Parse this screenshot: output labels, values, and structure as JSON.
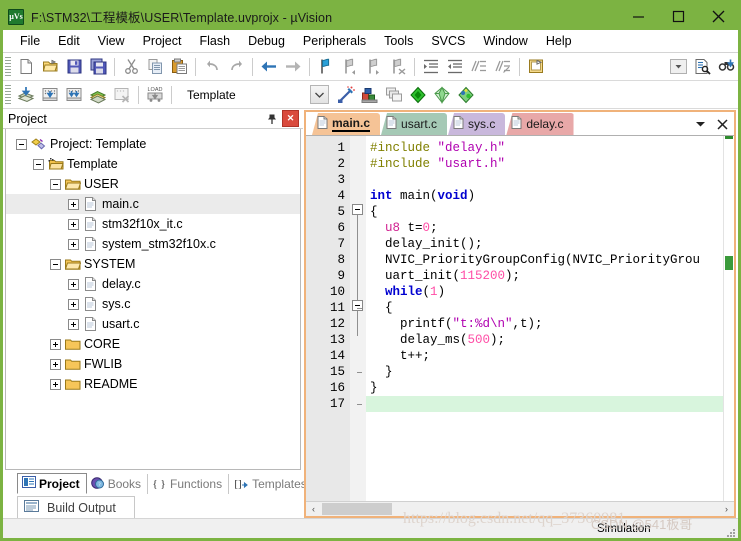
{
  "window": {
    "title": "F:\\STM32\\工程模板\\USER\\Template.uvprojx - µVision",
    "logo_text": "µVs",
    "minimize_label": "Minimize",
    "maximize_label": "Maximize",
    "close_label": "Close"
  },
  "menubar": {
    "items": [
      {
        "label": "File"
      },
      {
        "label": "Edit"
      },
      {
        "label": "View"
      },
      {
        "label": "Project"
      },
      {
        "label": "Flash"
      },
      {
        "label": "Debug"
      },
      {
        "label": "Peripherals"
      },
      {
        "label": "Tools"
      },
      {
        "label": "SVCS"
      },
      {
        "label": "Window"
      },
      {
        "label": "Help"
      }
    ]
  },
  "toolbar_main": {
    "buttons": [
      {
        "name": "new-file-icon",
        "tooltip": "New"
      },
      {
        "name": "open-file-icon",
        "tooltip": "Open"
      },
      {
        "name": "save-icon",
        "tooltip": "Save"
      },
      {
        "name": "save-all-icon",
        "tooltip": "Save All"
      },
      {
        "name": "cut-icon",
        "tooltip": "Cut"
      },
      {
        "name": "copy-icon",
        "tooltip": "Copy"
      },
      {
        "name": "paste-icon",
        "tooltip": "Paste"
      },
      {
        "name": "undo-icon",
        "tooltip": "Undo"
      },
      {
        "name": "redo-icon",
        "tooltip": "Redo"
      },
      {
        "name": "navigate-back-icon",
        "tooltip": "Back"
      },
      {
        "name": "navigate-forward-icon",
        "tooltip": "Forward"
      },
      {
        "name": "bookmark-toggle-icon",
        "tooltip": "Insert/Remove Bookmark"
      },
      {
        "name": "bookmark-prev-icon",
        "tooltip": "Previous Bookmark"
      },
      {
        "name": "bookmark-next-icon",
        "tooltip": "Next Bookmark"
      },
      {
        "name": "bookmark-clear-icon",
        "tooltip": "Clear All Bookmarks"
      },
      {
        "name": "indent-icon",
        "tooltip": "Indent Selected Text"
      },
      {
        "name": "outdent-icon",
        "tooltip": "Outdent Selected Text"
      },
      {
        "name": "comment-icon",
        "tooltip": "Comment Selection"
      },
      {
        "name": "uncomment-icon",
        "tooltip": "Uncomment Selection"
      },
      {
        "name": "bookmark-list-icon",
        "tooltip": "Bookmarks"
      }
    ],
    "right_buttons": [
      {
        "name": "find-combo-arrow-icon",
        "tooltip": "Find Combo"
      },
      {
        "name": "find-in-files-icon",
        "tooltip": "Find in Files"
      },
      {
        "name": "find-next-icon",
        "tooltip": "Find Next"
      }
    ]
  },
  "toolbar_build": {
    "buttons": [
      {
        "name": "translate-icon",
        "tooltip": "Translate Current File"
      },
      {
        "name": "build-icon",
        "tooltip": "Build"
      },
      {
        "name": "rebuild-icon",
        "tooltip": "Rebuild"
      },
      {
        "name": "batch-build-icon",
        "tooltip": "Batch Build"
      },
      {
        "name": "stop-build-icon",
        "tooltip": "Stop Build"
      },
      {
        "name": "download-icon",
        "tooltip": "Download (LOAD)"
      }
    ],
    "target_label": "Template",
    "right_buttons": [
      {
        "name": "options-target-icon",
        "tooltip": "Options for Target"
      },
      {
        "name": "manage-components-icon",
        "tooltip": "Manage Project Items"
      },
      {
        "name": "multi-project-icon",
        "tooltip": "Manage Multi-Project"
      },
      {
        "name": "pack-installer-icon",
        "tooltip": "Pack Installer"
      },
      {
        "name": "run-config-wizard-icon",
        "tooltip": "Configuration Wizard"
      },
      {
        "name": "manage-run-env-icon",
        "tooltip": "Manage Run-Time Environment"
      }
    ]
  },
  "project_panel": {
    "title": "Project",
    "pin_label": "Auto Hide",
    "close_label": "Close",
    "tree": [
      {
        "label": "Project: Template",
        "depth": 0,
        "expander": "minus",
        "icon": "project-icon",
        "selected": false
      },
      {
        "label": "Template",
        "depth": 1,
        "expander": "minus",
        "icon": "target-icon",
        "selected": false
      },
      {
        "label": "USER",
        "depth": 2,
        "expander": "minus",
        "icon": "folder-open-icon",
        "selected": false
      },
      {
        "label": "main.c",
        "depth": 3,
        "expander": "plus",
        "icon": "c-file-icon",
        "selected": true
      },
      {
        "label": "stm32f10x_it.c",
        "depth": 3,
        "expander": "plus",
        "icon": "c-file-icon",
        "selected": false
      },
      {
        "label": "system_stm32f10x.c",
        "depth": 3,
        "expander": "plus",
        "icon": "c-file-icon",
        "selected": false
      },
      {
        "label": "SYSTEM",
        "depth": 2,
        "expander": "minus",
        "icon": "folder-open-icon",
        "selected": false
      },
      {
        "label": "delay.c",
        "depth": 3,
        "expander": "plus",
        "icon": "c-file-icon",
        "selected": false
      },
      {
        "label": "sys.c",
        "depth": 3,
        "expander": "plus",
        "icon": "c-file-icon",
        "selected": false
      },
      {
        "label": "usart.c",
        "depth": 3,
        "expander": "plus",
        "icon": "c-file-icon",
        "selected": false
      },
      {
        "label": "CORE",
        "depth": 2,
        "expander": "plus",
        "icon": "folder-closed-icon",
        "selected": false
      },
      {
        "label": "FWLIB",
        "depth": 2,
        "expander": "plus",
        "icon": "folder-closed-icon",
        "selected": false
      },
      {
        "label": "README",
        "depth": 2,
        "expander": "plus",
        "icon": "folder-closed-icon",
        "selected": false
      }
    ],
    "dock_tabs": [
      {
        "label": "Project",
        "icon": "project-tab-icon",
        "active": true
      },
      {
        "label": "Books",
        "icon": "books-tab-icon",
        "active": false
      },
      {
        "label": "Functions",
        "icon": "functions-tab-icon",
        "active": false
      },
      {
        "label": "Templates",
        "icon": "templates-tab-icon",
        "active": false
      }
    ]
  },
  "editor": {
    "tabs": [
      {
        "label": "main.c",
        "color": "#f5c396",
        "active": true
      },
      {
        "label": "usart.c",
        "color": "#a5c9b5",
        "active": false
      },
      {
        "label": "sys.c",
        "color": "#c9b8dc",
        "active": false
      },
      {
        "label": "delay.c",
        "color": "#e8a8a8",
        "active": false
      }
    ],
    "tab_menu_icon": "tab-list-chevron-icon",
    "tab_close_icon": "tab-close-icon",
    "current_line": 17,
    "lines": [
      {
        "n": 1,
        "tokens": [
          {
            "t": "#include ",
            "c": "pp"
          },
          {
            "t": "\"delay.h\"",
            "c": "st"
          }
        ]
      },
      {
        "n": 2,
        "tokens": [
          {
            "t": "#include ",
            "c": "pp"
          },
          {
            "t": "\"usart.h\"",
            "c": "st"
          }
        ]
      },
      {
        "n": 3,
        "tokens": []
      },
      {
        "n": 4,
        "tokens": [
          {
            "t": "int ",
            "c": "k"
          },
          {
            "t": "main",
            "c": "pl"
          },
          {
            "t": "(",
            "c": "pl"
          },
          {
            "t": "void",
            "c": "k"
          },
          {
            "t": ")",
            "c": "pl"
          }
        ]
      },
      {
        "n": 5,
        "tokens": [
          {
            "t": "{",
            "c": "pl"
          }
        ]
      },
      {
        "n": 6,
        "tokens": [
          {
            "t": "  ",
            "c": "pl"
          },
          {
            "t": "u8",
            "c": "ty"
          },
          {
            "t": " t=",
            "c": "pl"
          },
          {
            "t": "0",
            "c": "nm"
          },
          {
            "t": ";",
            "c": "pl"
          }
        ]
      },
      {
        "n": 7,
        "tokens": [
          {
            "t": "  delay_init();",
            "c": "pl"
          }
        ]
      },
      {
        "n": 8,
        "tokens": [
          {
            "t": "  NVIC_PriorityGroupConfig(NVIC_PriorityGrou",
            "c": "pl"
          }
        ]
      },
      {
        "n": 9,
        "tokens": [
          {
            "t": "  uart_init(",
            "c": "pl"
          },
          {
            "t": "115200",
            "c": "nm"
          },
          {
            "t": ");",
            "c": "pl"
          }
        ]
      },
      {
        "n": 10,
        "tokens": [
          {
            "t": "  ",
            "c": "pl"
          },
          {
            "t": "while",
            "c": "k"
          },
          {
            "t": "(",
            "c": "pl"
          },
          {
            "t": "1",
            "c": "nm"
          },
          {
            "t": ")",
            "c": "pl"
          }
        ]
      },
      {
        "n": 11,
        "tokens": [
          {
            "t": "  {",
            "c": "pl"
          }
        ]
      },
      {
        "n": 12,
        "tokens": [
          {
            "t": "    printf(",
            "c": "pl"
          },
          {
            "t": "\"t:%d\\n\"",
            "c": "st"
          },
          {
            "t": ",t);",
            "c": "pl"
          }
        ]
      },
      {
        "n": 13,
        "tokens": [
          {
            "t": "    delay_ms(",
            "c": "pl"
          },
          {
            "t": "500",
            "c": "nm"
          },
          {
            "t": ");",
            "c": "pl"
          }
        ]
      },
      {
        "n": 14,
        "tokens": [
          {
            "t": "    t++;",
            "c": "pl"
          }
        ]
      },
      {
        "n": 15,
        "tokens": [
          {
            "t": "  }",
            "c": "pl"
          }
        ]
      },
      {
        "n": 16,
        "tokens": [
          {
            "t": "}",
            "c": "pl"
          }
        ]
      },
      {
        "n": 17,
        "tokens": []
      }
    ],
    "hscroll": {
      "left_arrow": "‹",
      "right_arrow": "›"
    }
  },
  "build_output": {
    "tab_label": "Build Output",
    "tab_icon": "build-output-icon"
  },
  "statusbar": {
    "simulation_label": "Simulation"
  },
  "watermark": {
    "url": "https://blog.csdn.net/qq_37360981",
    "tag": "CSDN @541板哥"
  }
}
